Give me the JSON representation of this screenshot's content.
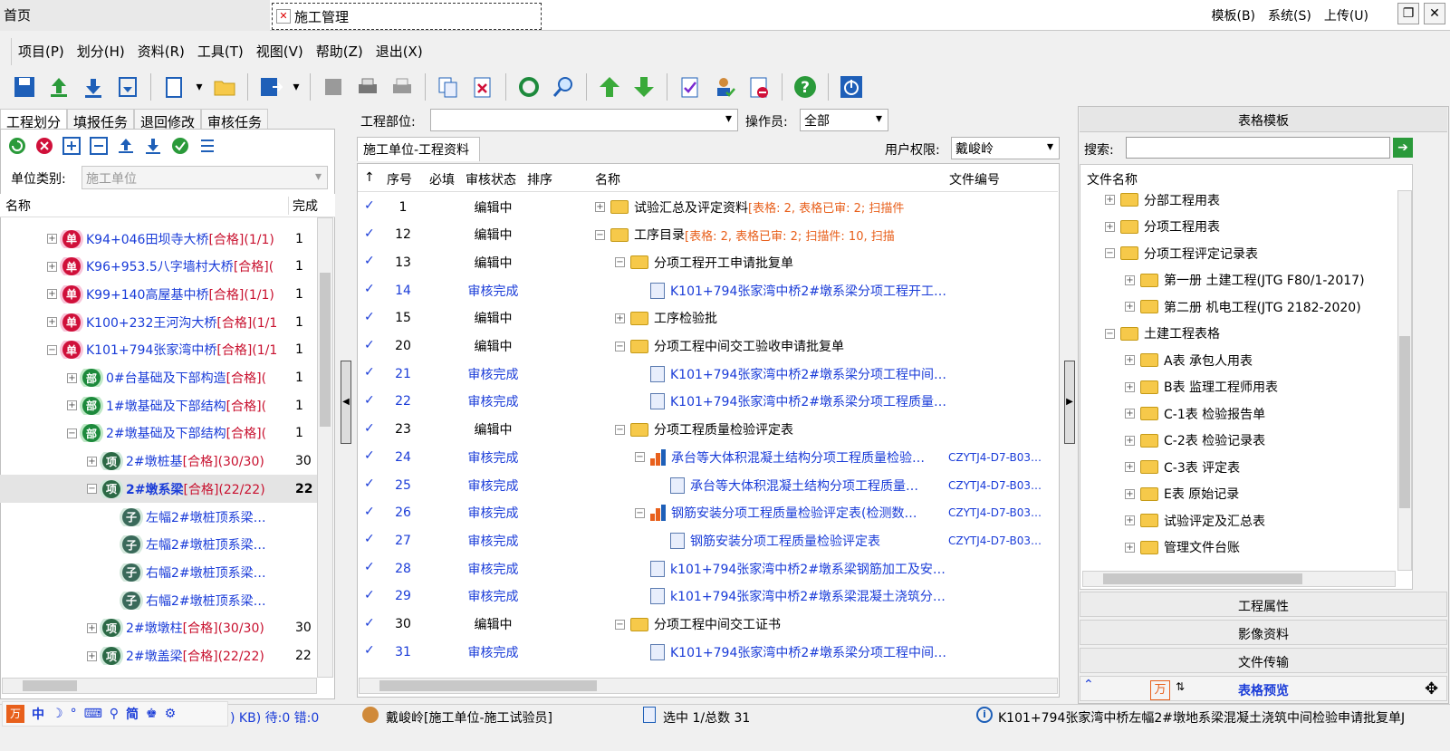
{
  "tabs": {
    "home": "首页",
    "active": "施工管理"
  },
  "topmenu": [
    "模板(B)",
    "系统(S)",
    "上传(U)"
  ],
  "menu": [
    "项目(P)",
    "划分(H)",
    "资料(R)",
    "工具(T)",
    "视图(V)",
    "帮助(Z)",
    "退出(X)"
  ],
  "left": {
    "tabs": [
      "工程划分",
      "填报任务",
      "退回修改",
      "审核任务"
    ],
    "unit_label": "单位类别:",
    "unit_value": "施工单位",
    "col_name": "名称",
    "col_done": "完成",
    "rows": [
      {
        "badge": "单",
        "text": "K94+046田坝寺大桥",
        "tag": " [合格](1/1)",
        "done": "1",
        "indent": 0,
        "pm": "+"
      },
      {
        "badge": "单",
        "text": "K96+953.5八字墙村大桥",
        "tag": " [合格](",
        "done": "1",
        "indent": 0,
        "pm": "+"
      },
      {
        "badge": "单",
        "text": "K99+140高屋基中桥",
        "tag": " [合格](1/1)",
        "done": "1",
        "indent": 0,
        "pm": "+"
      },
      {
        "badge": "单",
        "text": "K100+232王河沟大桥",
        "tag": " [合格](1/1",
        "done": "1",
        "indent": 0,
        "pm": "+"
      },
      {
        "badge": "单",
        "text": "K101+794张家湾中桥",
        "tag": " [合格](1/1",
        "done": "1",
        "indent": 0,
        "pm": "−"
      },
      {
        "badge": "部",
        "text": "0#台基础及下部构造",
        "tag": " [合格](",
        "done": "1",
        "indent": 1,
        "pm": "+"
      },
      {
        "badge": "部",
        "text": "1#墩基础及下部结构",
        "tag": " [合格](",
        "done": "1",
        "indent": 1,
        "pm": "+"
      },
      {
        "badge": "部",
        "text": "2#墩基础及下部结构",
        "tag": " [合格](",
        "done": "1",
        "indent": 1,
        "pm": "−"
      },
      {
        "badge": "项",
        "text": "2#墩桩基",
        "tag": " [合格](30/30)",
        "done": "30",
        "indent": 2,
        "pm": "+"
      },
      {
        "badge": "项",
        "text": "2#墩系梁",
        "tag": " [合格](22/22)",
        "done": "22",
        "indent": 2,
        "pm": "−",
        "selected": true
      },
      {
        "badge": "子",
        "text": "左幅2#墩桩顶系梁…",
        "tag": "",
        "done": "",
        "indent": 3,
        "pm": ""
      },
      {
        "badge": "子",
        "text": "左幅2#墩桩顶系梁…",
        "tag": "",
        "done": "",
        "indent": 3,
        "pm": ""
      },
      {
        "badge": "子",
        "text": "右幅2#墩桩顶系梁…",
        "tag": "",
        "done": "",
        "indent": 3,
        "pm": ""
      },
      {
        "badge": "子",
        "text": "右幅2#墩桩顶系梁…",
        "tag": "",
        "done": "",
        "indent": 3,
        "pm": ""
      },
      {
        "badge": "项",
        "text": "2#墩墩柱",
        "tag": " [合格](30/30)",
        "done": "30",
        "indent": 2,
        "pm": "+"
      },
      {
        "badge": "项",
        "text": "2#墩盖梁",
        "tag": " [合格](22/22)",
        "done": "22",
        "indent": 2,
        "pm": "+"
      }
    ]
  },
  "middle": {
    "part_label": "工程部位:",
    "operator_label": "操作员:",
    "operator_value": "全部",
    "tab": "施工单位-工程资料",
    "perm_label": "用户权限:",
    "perm_value": "戴峻岭",
    "headers": [
      "↑",
      "序号",
      "必填",
      "审核状态",
      "排序",
      "名称",
      "文件编号"
    ],
    "rows": [
      {
        "no": "1",
        "status": "编辑中",
        "name": "试验汇总及评定资料",
        "extra": " [表格: 2, 表格已审: 2; 扫描件",
        "code": "",
        "indent": 0,
        "type": "folder",
        "pm": "+",
        "blue": false
      },
      {
        "no": "12",
        "status": "编辑中",
        "name": "工序目录",
        "extra": " [表格: 2, 表格已审: 2; 扫描件: 10, 扫描",
        "code": "",
        "indent": 0,
        "type": "folder",
        "pm": "−",
        "blue": false
      },
      {
        "no": "13",
        "status": "编辑中",
        "name": "分项工程开工申请批复单",
        "extra": "",
        "code": "",
        "indent": 1,
        "type": "folder",
        "pm": "−",
        "blue": false
      },
      {
        "no": "14",
        "status": "审核完成",
        "name": "K101+794张家湾中桥2#墩系梁分项工程开工…",
        "extra": "",
        "code": "",
        "indent": 2,
        "type": "doc",
        "pm": "",
        "blue": true
      },
      {
        "no": "15",
        "status": "编辑中",
        "name": "工序检验批",
        "extra": "",
        "code": "",
        "indent": 1,
        "type": "folder",
        "pm": "+",
        "blue": false
      },
      {
        "no": "20",
        "status": "编辑中",
        "name": "分项工程中间交工验收申请批复单",
        "extra": "",
        "code": "",
        "indent": 1,
        "type": "folder",
        "pm": "−",
        "blue": false
      },
      {
        "no": "21",
        "status": "审核完成",
        "name": "K101+794张家湾中桥2#墩系梁分项工程中间…",
        "extra": "",
        "code": "",
        "indent": 2,
        "type": "doc",
        "pm": "",
        "blue": true
      },
      {
        "no": "22",
        "status": "审核完成",
        "name": "K101+794张家湾中桥2#墩系梁分项工程质量…",
        "extra": "",
        "code": "",
        "indent": 2,
        "type": "doc",
        "pm": "",
        "blue": true
      },
      {
        "no": "23",
        "status": "编辑中",
        "name": "分项工程质量检验评定表",
        "extra": "",
        "code": "",
        "indent": 1,
        "type": "folder",
        "pm": "−",
        "blue": false
      },
      {
        "no": "24",
        "status": "审核完成",
        "name": "承台等大体积混凝土结构分项工程质量检验…",
        "extra": "",
        "code": "CZYTJ4-D7-B03…",
        "indent": 2,
        "type": "chart",
        "pm": "−",
        "blue": true
      },
      {
        "no": "25",
        "status": "审核完成",
        "name": "承台等大体积混凝土结构分项工程质量…",
        "extra": "",
        "code": "CZYTJ4-D7-B03…",
        "indent": 3,
        "type": "doc",
        "pm": "",
        "blue": true
      },
      {
        "no": "26",
        "status": "审核完成",
        "name": "钢筋安装分项工程质量检验评定表(检测数…",
        "extra": "",
        "code": "CZYTJ4-D7-B03…",
        "indent": 2,
        "type": "chart",
        "pm": "−",
        "blue": true
      },
      {
        "no": "27",
        "status": "审核完成",
        "name": "钢筋安装分项工程质量检验评定表",
        "extra": "",
        "code": "CZYTJ4-D7-B03…",
        "indent": 3,
        "type": "doc",
        "pm": "",
        "blue": true
      },
      {
        "no": "28",
        "status": "审核完成",
        "name": "k101+794张家湾中桥2#墩系梁钢筋加工及安…",
        "extra": "",
        "code": "",
        "indent": 2,
        "type": "doc",
        "pm": "",
        "blue": true
      },
      {
        "no": "29",
        "status": "审核完成",
        "name": "k101+794张家湾中桥2#墩系梁混凝土浇筑分…",
        "extra": "",
        "code": "",
        "indent": 2,
        "type": "doc",
        "pm": "",
        "blue": true
      },
      {
        "no": "30",
        "status": "编辑中",
        "name": "分项工程中间交工证书",
        "extra": "",
        "code": "",
        "indent": 1,
        "type": "folder",
        "pm": "−",
        "blue": false
      },
      {
        "no": "31",
        "status": "审核完成",
        "name": "K101+794张家湾中桥2#墩系梁分项工程中间…",
        "extra": "",
        "code": "",
        "indent": 2,
        "type": "doc",
        "pm": "",
        "blue": true
      }
    ]
  },
  "right": {
    "title": "表格模板",
    "search_label": "搜索:",
    "col": "文件名称",
    "rows": [
      {
        "text": "分部工程用表",
        "indent": 0,
        "pm": "+"
      },
      {
        "text": "分项工程用表",
        "indent": 0,
        "pm": "+"
      },
      {
        "text": "分项工程评定记录表",
        "indent": 0,
        "pm": "−"
      },
      {
        "text": "第一册 土建工程(JTG F80/1-2017)",
        "indent": 1,
        "pm": "+"
      },
      {
        "text": "第二册 机电工程(JTG 2182-2020)",
        "indent": 1,
        "pm": "+"
      },
      {
        "text": "土建工程表格",
        "indent": 0,
        "pm": "−"
      },
      {
        "text": "A表 承包人用表",
        "indent": 1,
        "pm": "+"
      },
      {
        "text": "B表 监理工程师用表",
        "indent": 1,
        "pm": "+"
      },
      {
        "text": "C-1表 检验报告单",
        "indent": 1,
        "pm": "+"
      },
      {
        "text": "C-2表 检验记录表",
        "indent": 1,
        "pm": "+"
      },
      {
        "text": "C-3表 评定表",
        "indent": 1,
        "pm": "+"
      },
      {
        "text": "E表 原始记录",
        "indent": 1,
        "pm": "+"
      },
      {
        "text": "试验评定及汇总表",
        "indent": 1,
        "pm": "+"
      },
      {
        "text": "管理文件台账",
        "indent": 1,
        "pm": "+"
      }
    ],
    "sections": [
      "工程属性",
      "影像资料",
      "文件传输"
    ],
    "preview": "表格预览"
  },
  "status": {
    "ime": [
      "中",
      "简"
    ],
    "left": ") KB) 待:0 错:0",
    "user": "戴峻岭[施工单位-施工试验员]",
    "count": "选中 1/总数 31",
    "msg": "K101+794张家湾中桥左幅2#墩地系梁混凝土浇筑中间检验申请批复单J"
  }
}
